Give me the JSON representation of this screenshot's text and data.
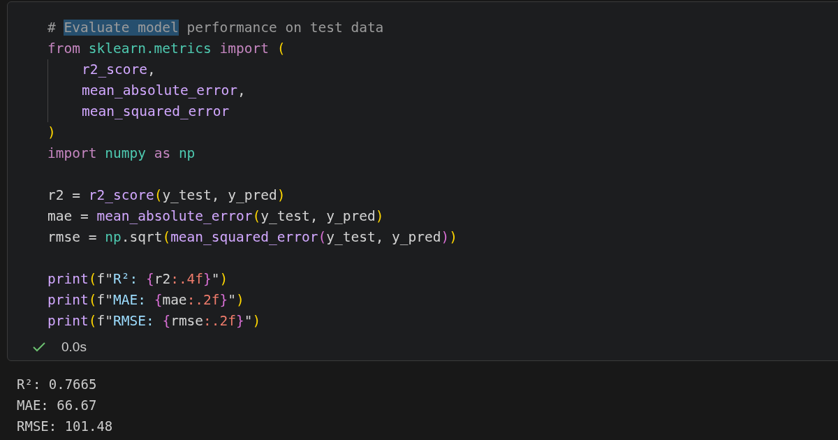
{
  "cell": {
    "blocks": [
      [
        {
          "tokens": [
            {
              "text": "# ",
              "kind": "comment",
              "highlighted": false
            },
            {
              "text": "Evaluate model",
              "kind": "comment",
              "highlighted": true
            },
            {
              "text": " performance on test data",
              "kind": "comment",
              "highlighted": false
            }
          ]
        },
        {
          "tokens": [
            {
              "text": "from ",
              "kind": "keyword"
            },
            {
              "text": "sklearn.metrics ",
              "kind": "module"
            },
            {
              "text": "import ",
              "kind": "keyword"
            },
            {
              "text": "(",
              "kind": "paren"
            }
          ],
          "children": [
            {
              "tokens": [
                {
                  "text": "r2_score",
                  "kind": "function"
                },
                {
                  "text": ",",
                  "kind": "plain"
                }
              ]
            },
            {
              "tokens": [
                {
                  "text": "mean_absolute_error",
                  "kind": "function"
                },
                {
                  "text": ",",
                  "kind": "plain"
                }
              ]
            },
            {
              "tokens": [
                {
                  "text": "mean_squared_error",
                  "kind": "function"
                }
              ]
            }
          ]
        },
        {
          "tokens": [
            {
              "text": ")",
              "kind": "paren"
            }
          ]
        },
        {
          "tokens": [
            {
              "text": "import ",
              "kind": "keyword"
            },
            {
              "text": "numpy ",
              "kind": "module"
            },
            {
              "text": "as ",
              "kind": "keyword"
            },
            {
              "text": "np",
              "kind": "module"
            }
          ]
        }
      ],
      [
        {
          "tokens": [
            {
              "text": "r2 = ",
              "kind": "plain"
            },
            {
              "text": "r2_score",
              "kind": "function"
            },
            {
              "text": "(",
              "kind": "paren"
            },
            {
              "text": "y_test, y_pred",
              "kind": "plain"
            },
            {
              "text": ")",
              "kind": "paren"
            }
          ]
        },
        {
          "tokens": [
            {
              "text": "mae = ",
              "kind": "plain"
            },
            {
              "text": "mean_absolute_error",
              "kind": "function"
            },
            {
              "text": "(",
              "kind": "paren"
            },
            {
              "text": "y_test, y_pred",
              "kind": "plain"
            },
            {
              "text": ")",
              "kind": "paren"
            }
          ]
        },
        {
          "tokens": [
            {
              "text": "rmse = ",
              "kind": "plain"
            },
            {
              "text": "np",
              "kind": "module"
            },
            {
              "text": ".sqrt",
              "kind": "plain"
            },
            {
              "text": "(",
              "kind": "paren"
            },
            {
              "text": "mean_squared_error",
              "kind": "function"
            },
            {
              "text": "(",
              "kind": "paren2"
            },
            {
              "text": "y_test, y_pred",
              "kind": "plain"
            },
            {
              "text": ")",
              "kind": "paren2"
            },
            {
              "text": ")",
              "kind": "paren"
            }
          ]
        }
      ],
      [
        {
          "tokens": [
            {
              "text": "print",
              "kind": "function"
            },
            {
              "text": "(",
              "kind": "paren"
            },
            {
              "text": "f\"",
              "kind": "plain"
            },
            {
              "text": "R²: ",
              "kind": "string"
            },
            {
              "text": "{",
              "kind": "brace"
            },
            {
              "text": "r2",
              "kind": "plain"
            },
            {
              "text": ":.4f",
              "kind": "format"
            },
            {
              "text": "}",
              "kind": "brace"
            },
            {
              "text": "\"",
              "kind": "plain"
            },
            {
              "text": ")",
              "kind": "paren"
            }
          ]
        },
        {
          "tokens": [
            {
              "text": "print",
              "kind": "function"
            },
            {
              "text": "(",
              "kind": "paren"
            },
            {
              "text": "f\"",
              "kind": "plain"
            },
            {
              "text": "MAE: ",
              "kind": "string"
            },
            {
              "text": "{",
              "kind": "brace"
            },
            {
              "text": "mae",
              "kind": "plain"
            },
            {
              "text": ":.2f",
              "kind": "format"
            },
            {
              "text": "}",
              "kind": "brace"
            },
            {
              "text": "\"",
              "kind": "plain"
            },
            {
              "text": ")",
              "kind": "paren"
            }
          ]
        },
        {
          "tokens": [
            {
              "text": "print",
              "kind": "function"
            },
            {
              "text": "(",
              "kind": "paren"
            },
            {
              "text": "f\"",
              "kind": "plain"
            },
            {
              "text": "RMSE: ",
              "kind": "string"
            },
            {
              "text": "{",
              "kind": "brace"
            },
            {
              "text": "rmse",
              "kind": "plain"
            },
            {
              "text": ":.2f",
              "kind": "format"
            },
            {
              "text": "}",
              "kind": "brace"
            },
            {
              "text": "\"",
              "kind": "plain"
            },
            {
              "text": ")",
              "kind": "paren"
            }
          ]
        }
      ]
    ],
    "status": {
      "succeeded": true,
      "duration": "0.0s"
    }
  },
  "output": [
    "R²: 0.7665",
    "MAE: 66.67",
    "RMSE: 101.48"
  ]
}
